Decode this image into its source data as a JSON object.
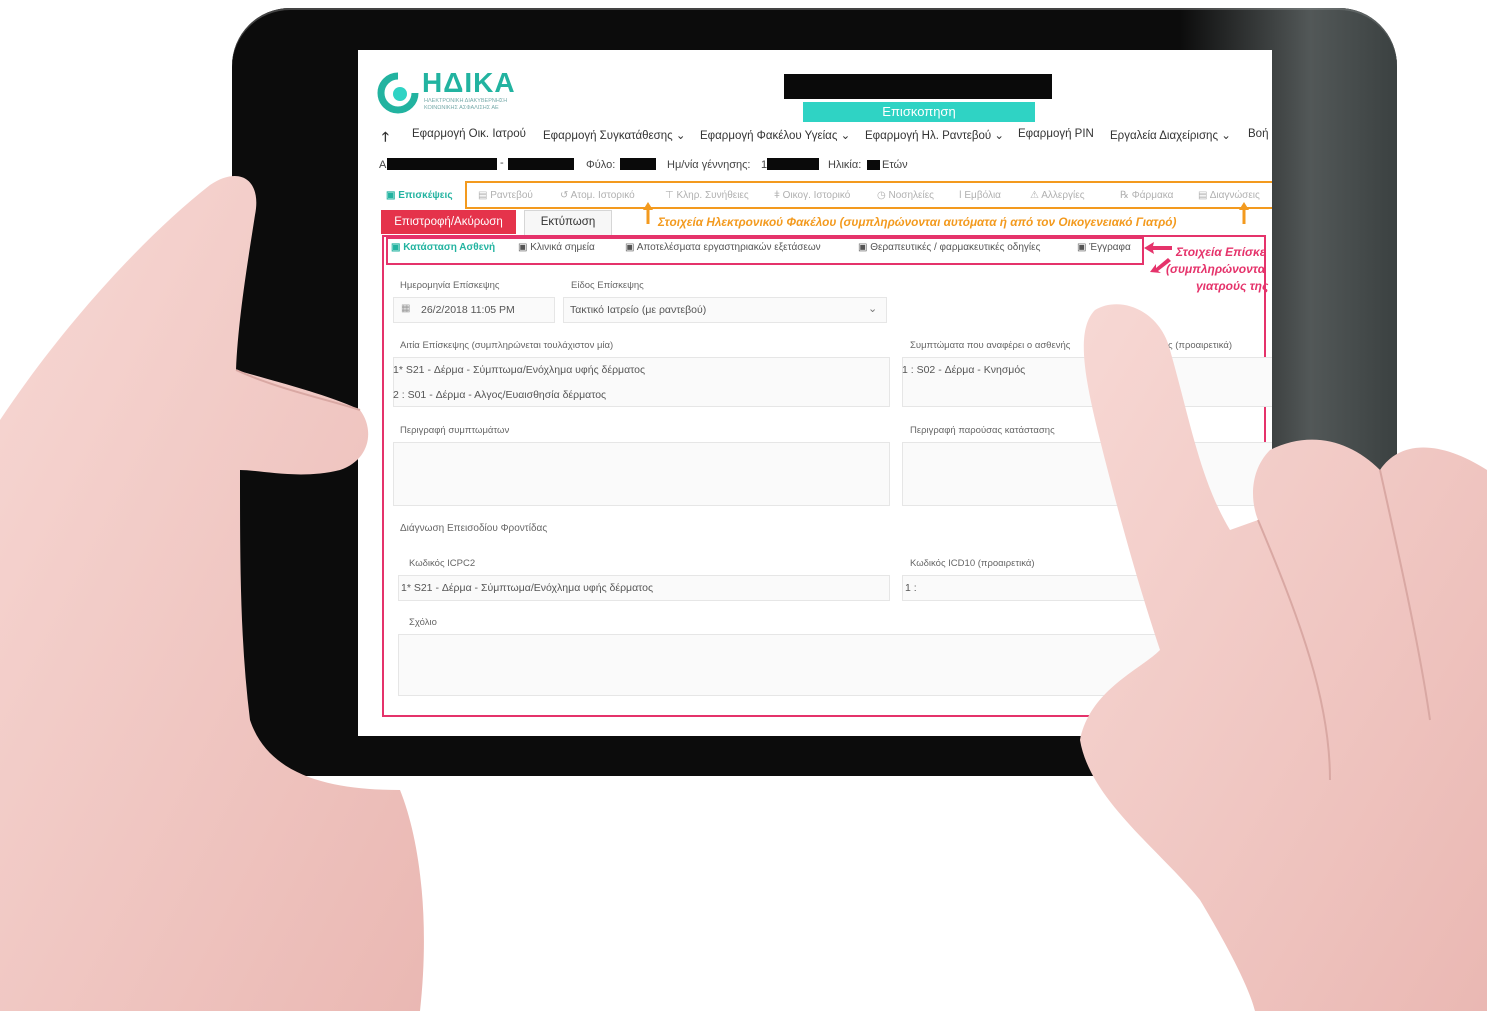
{
  "app": {
    "logo_text": "ΗΔΙΚΑ",
    "logo_subtitle": "ΗΛΕΚΤΡΟΝΙΚΗ ΔΙΑΚΥΒΕΡΝΗΣΗ ΚΟΙΝΩΝΙΚΗΣ ΑΣΦΑΛΙΣΗΣ ΑΕ",
    "header_badge": "Επισκοπηση",
    "accent_color": "#2fd3c4",
    "brand_color": "#22b3a0"
  },
  "menu": {
    "items": [
      "Εφαρμογή Οικ. Ιατρού",
      "Εφαρμογή Συγκατάθεσης",
      "Εφαρμογή Φακέλου Υγείας",
      "Εφαρμογή Ηλ. Ραντεβού",
      "Εφαρμογή PIN",
      "Εργαλεία Διαχείρισης",
      "Βοή"
    ]
  },
  "patient": {
    "prefix": "Α",
    "sex_label": "Φύλο:",
    "dob_label": "Ημ/νία γέννησης:",
    "dob_prefix": "1",
    "age_label": "Ηλικία:",
    "age_unit": "Ετών"
  },
  "tabs_primary": [
    "Επισκέψεις",
    "Ραντεβού",
    "Ατομ. Ιστορικό",
    "Κληρ. Συνήθειες",
    "Οικογ. Ιστορικό",
    "Νοσηλείες",
    "Εμβόλια",
    "Αλλεργίες",
    "Φάρμακα",
    "Διαγνώσεις"
  ],
  "actions": {
    "back": "Επιστροφή/Ακύρωση",
    "print": "Εκτύπωση"
  },
  "tabs_secondary": [
    "Κατάσταση Ασθενή",
    "Κλινικά σημεία",
    "Αποτελέσματα εργαστηριακών εξετάσεων",
    "Θεραπευτικές / φαρμακευτικές οδηγίες",
    "Έγγραφα"
  ],
  "form": {
    "visit_date_label": "Ημερομηνία Επίσκεψης",
    "visit_date_value": "26/2/2018 11:05 PM",
    "visit_type_label": "Είδος Επίσκεψης",
    "visit_type_value": "Τακτικό Ιατρείο (με ραντεβού)",
    "reason_label": "Αιτία Επίσκεψης (συμπληρώνεται τουλάχιστον μία)",
    "reasons": [
      "1*  S21 - Δέρμα - Σύμπτωμα/Ενόχλημα υφής δέρματος",
      "2 :  S01 - Δέρμα - Αλγος/Ευαισθησία δέρματος"
    ],
    "symptoms_label": "Συμπτώματα που αναφέρει ο ασθενής",
    "symptoms_label_tail": "ψης (προαιρετικά)",
    "symptoms": [
      "1 :  S02 - Δέρμα - Κνησμός"
    ],
    "symptom_desc_label": "Περιγραφή συμπτωμάτων",
    "condition_desc_label": "Περιγραφή παρούσας κατάστασης",
    "diagnosis_label": "Διάγνωση Επεισοδίου Φροντίδας",
    "icpc2_label": "Κωδικός ICPC2",
    "icpc2_value": "1*  S21 - Δέρμα - Σύμπτωμα/Ενόχλημα υφής δέρματος",
    "icd10_label": "Κωδικός ICD10 (προαιρετικά)",
    "icd10_value": "1 :",
    "comment_label": "Σχόλιο"
  },
  "annotations": {
    "orange_note": "Στοιχεία Ηλεκτρονικού Φακέλου (συμπληρώνονται αυτόματα ή από τον Οικογενειακό Γιατρό)",
    "pink_note_lines": [
      "Στοιχεία Επίσκε",
      "(συμπληρώνοντα",
      "γιατρούς της Π"
    ],
    "orange_color": "#f39a1e",
    "pink_color": "#e5336b"
  }
}
